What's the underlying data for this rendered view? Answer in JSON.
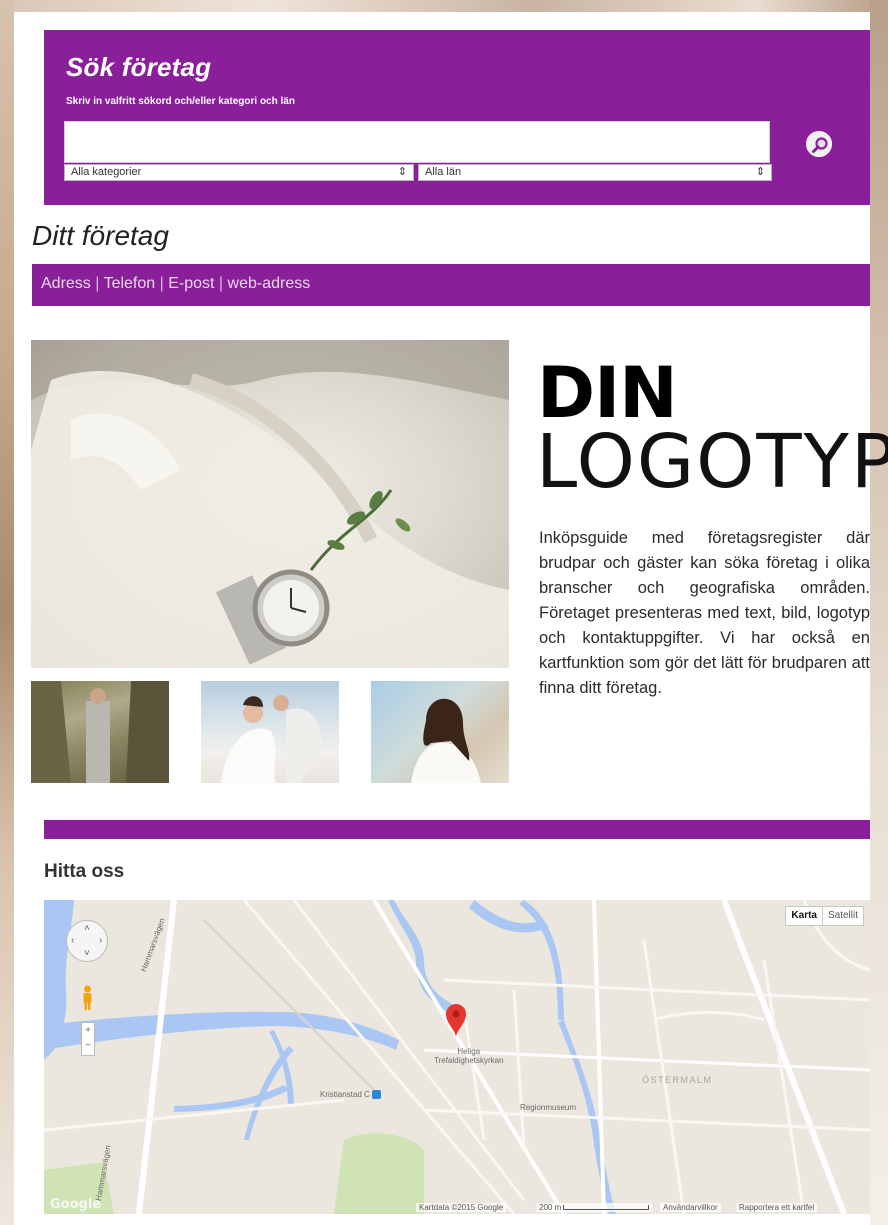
{
  "search": {
    "title": "Sök företag",
    "subtitle": "Skriv in valfritt sökord och/eller kategori och län",
    "input_value": "",
    "category_select": "Alla kategorier",
    "county_select": "Alla län",
    "select_arrows": "⇕"
  },
  "company": {
    "title": "Ditt företag",
    "contact": {
      "address": "Adress",
      "phone": "Telefon",
      "email": "E-post",
      "web": "web-adress",
      "separator": "|"
    }
  },
  "logo": {
    "line1": "DIN",
    "line2": "LOGOTYP"
  },
  "description": "Inköpsguide med företagsregister där brudpar och gäster kan söka företag i olika branscher och geografiska områden. Företaget presenteras med text, bild, logotyp och kontaktuppgifter. Vi har också en kartfunktion som gör det lätt för brudparen att finna ditt företag.",
  "map": {
    "heading": "Hitta oss",
    "type_map": "Karta",
    "type_satellite": "Satellit",
    "zoom_in": "+",
    "zoom_out": "−",
    "labels": {
      "church": "Heliga\nTrefaldighetskyrkan",
      "station": "Kristianstad C",
      "museum": "Regionmuseum",
      "district": "ÖSTERMALM",
      "road_left": "Hammarsvägen",
      "road_left2": "Hammarsvägen"
    },
    "footer": {
      "data": "Kartdata ©2015 Google",
      "scale": "200 m",
      "terms": "Användarvillkor",
      "report": "Rapportera ett kartfel"
    },
    "google": "Google"
  },
  "colors": {
    "brand_purple": "#8a1f9a",
    "water": "#a9c7f2",
    "park": "#cfe3b4"
  }
}
